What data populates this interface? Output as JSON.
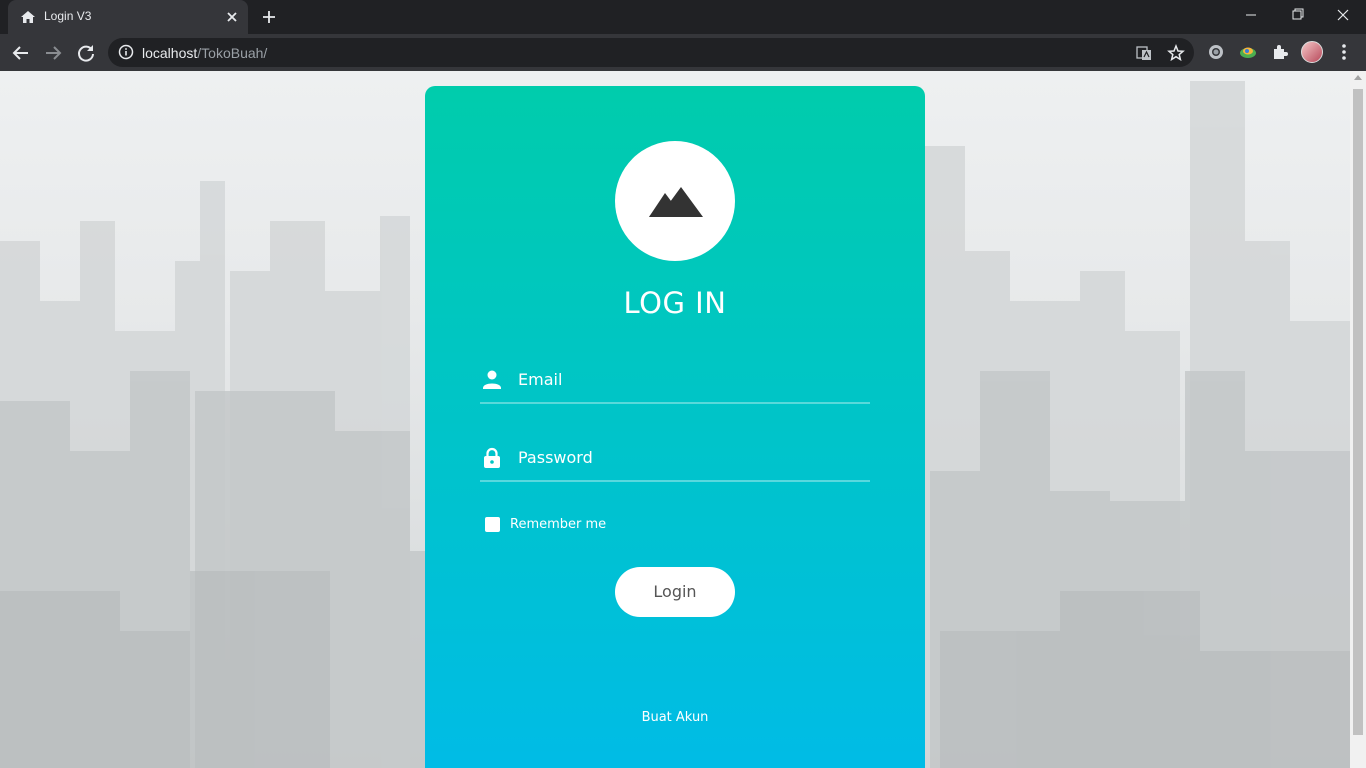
{
  "browser": {
    "tab_title": "Login V3",
    "url_host": "localhost",
    "url_path": "/TokoBuah/"
  },
  "login": {
    "title": "LOG IN",
    "email_placeholder": "Email",
    "password_placeholder": "Password",
    "remember_label": "Remember me",
    "login_button": "Login",
    "create_account_link": "Buat Akun"
  },
  "colors": {
    "card_top": "#00ccac",
    "card_bottom": "#00bce6"
  }
}
